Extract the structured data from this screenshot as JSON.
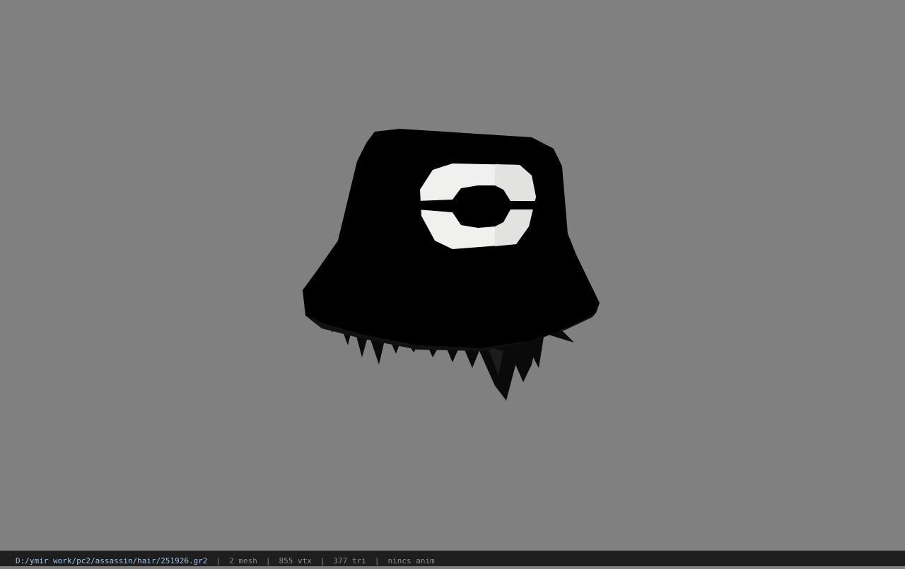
{
  "viewer": {
    "background_color": "#808080",
    "model_name": "hair-hat-model"
  },
  "status_bar": {
    "file_path": "D:/ymir work/pc2/assassin/hair/251926.gr2",
    "separator": "|",
    "mesh_count": "2 mesh",
    "vertex_count": "855 vtx",
    "triangle_count": "377 tri",
    "anim_status": "nincs anim",
    "path_color": "#9ec3e6",
    "text_color": "#8a8a8a"
  }
}
